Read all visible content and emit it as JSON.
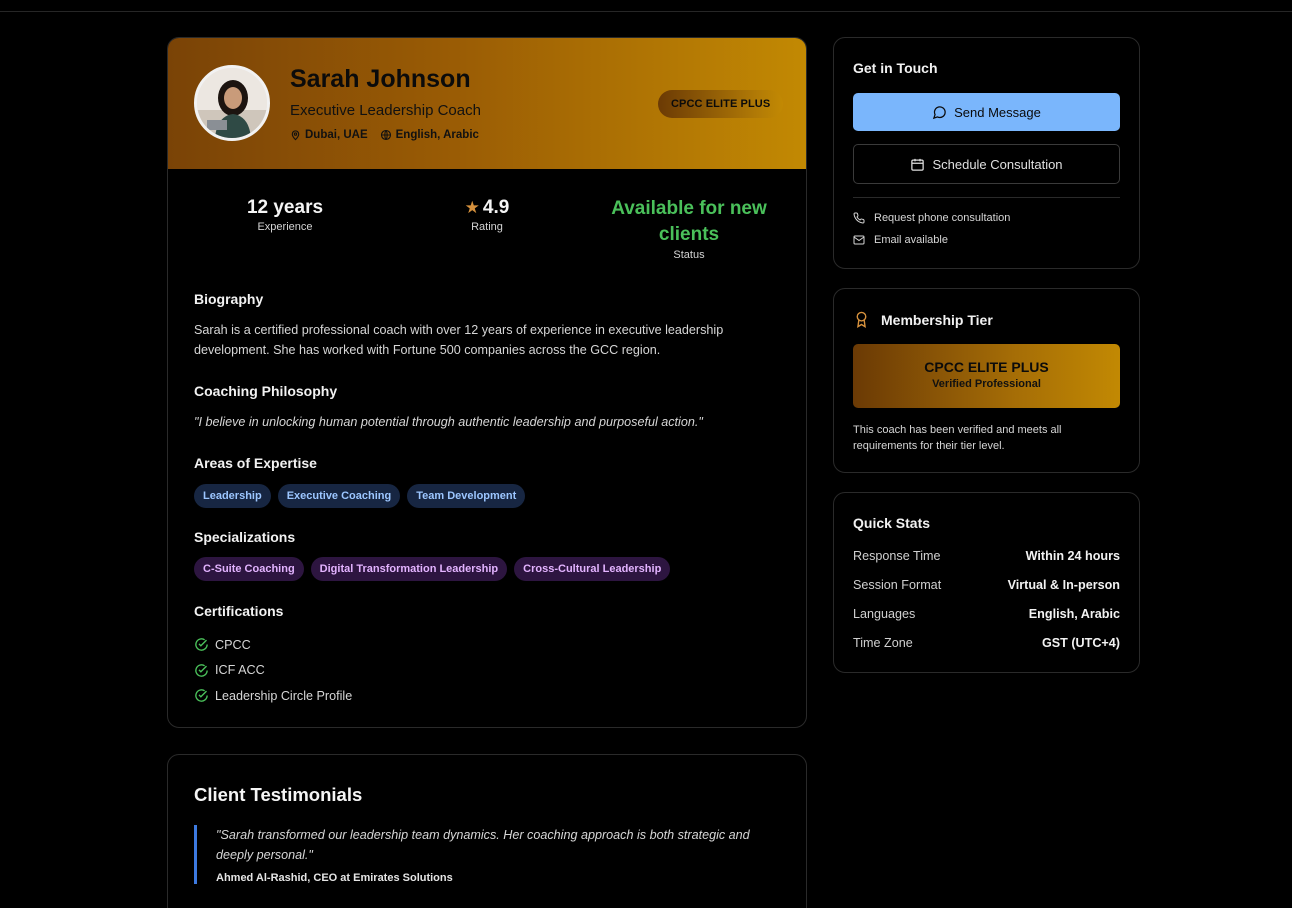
{
  "profile": {
    "name": "Sarah Johnson",
    "title": "Executive Leadership Coach",
    "location": "Dubai, UAE",
    "languages": "English, Arabic",
    "tier_badge": "CPCC ELITE PLUS"
  },
  "stats": {
    "experience_value": "12 years",
    "experience_label": "Experience",
    "rating_value": "4.9",
    "rating_label": "Rating",
    "status_value": "Available for new clients",
    "status_label": "Status"
  },
  "biography": {
    "heading": "Biography",
    "text": "Sarah is a certified professional coach with over 12 years of experience in executive leadership development. She has worked with Fortune 500 companies across the GCC region."
  },
  "philosophy": {
    "heading": "Coaching Philosophy",
    "text": "\"I believe in unlocking human potential through authentic leadership and purposeful action.\""
  },
  "expertise": {
    "heading": "Areas of Expertise",
    "tags": [
      "Leadership",
      "Executive Coaching",
      "Team Development"
    ]
  },
  "specializations": {
    "heading": "Specializations",
    "tags": [
      "C-Suite Coaching",
      "Digital Transformation Leadership",
      "Cross-Cultural Leadership"
    ]
  },
  "certifications": {
    "heading": "Certifications",
    "items": [
      "CPCC",
      "ICF ACC",
      "Leadership Circle Profile"
    ]
  },
  "testimonials": {
    "heading": "Client Testimonials",
    "items": [
      {
        "quote": "\"Sarah transformed our leadership team dynamics. Her coaching approach is both strategic and deeply personal.\"",
        "author": "Ahmed Al-Rashid, CEO at Emirates Solutions"
      }
    ]
  },
  "contact": {
    "heading": "Get in Touch",
    "send_message": "Send Message",
    "schedule": "Schedule Consultation",
    "phone": "Request phone consultation",
    "email": "Email available"
  },
  "membership": {
    "heading": "Membership Tier",
    "tier_name": "CPCC ELITE PLUS",
    "tier_sub": "Verified Professional",
    "note": "This coach has been verified and meets all requirements for their tier level."
  },
  "quick_stats": {
    "heading": "Quick Stats",
    "rows": [
      {
        "label": "Response Time",
        "value": "Within 24 hours"
      },
      {
        "label": "Session Format",
        "value": "Virtual & In-person"
      },
      {
        "label": "Languages",
        "value": "English, Arabic"
      },
      {
        "label": "Time Zone",
        "value": "GST (UTC+4)"
      }
    ]
  },
  "colors": {
    "accent_blue": "#7ab6fc",
    "gold_start": "#7a4306",
    "gold_end": "#c28903",
    "status_green": "#4ac05a"
  },
  "icons": {
    "location": "map-pin-icon",
    "language": "globe-icon",
    "rating": "star-icon",
    "certification": "check-circle-icon",
    "send": "message-circle-icon",
    "schedule": "calendar-icon",
    "phone": "phone-icon",
    "email": "mail-icon",
    "membership": "award-icon"
  }
}
